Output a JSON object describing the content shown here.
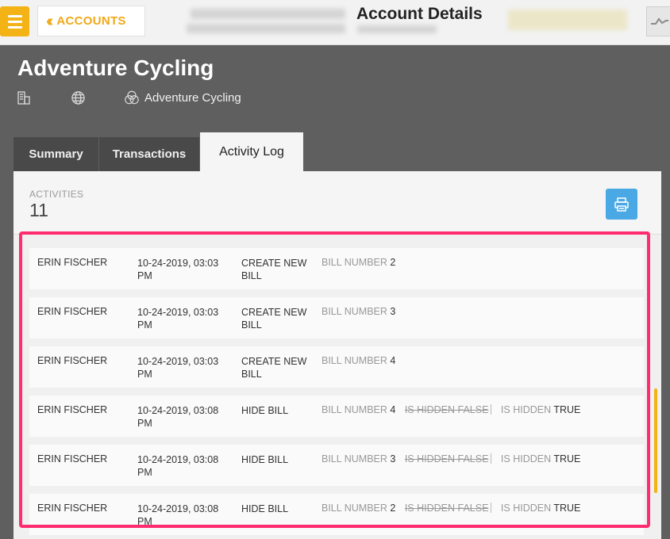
{
  "topbar": {
    "back_label": "ACCOUNTS",
    "title": "Account Details"
  },
  "account": {
    "name": "Adventure Cycling",
    "parent_name": "Adventure Cycling"
  },
  "tabs": [
    {
      "label": "Summary",
      "active": false
    },
    {
      "label": "Transactions",
      "active": false
    },
    {
      "label": "Activity Log",
      "active": true
    }
  ],
  "activity": {
    "label": "ACTIVITIES",
    "count": "11",
    "rows": [
      {
        "user": "ERIN FISCHER",
        "date": "10-24-2019, 03:03 PM",
        "action": "CREATE NEW BILL",
        "field1_label": "BILL NUMBER",
        "field1_value": "2"
      },
      {
        "user": "ERIN FISCHER",
        "date": "10-24-2019, 03:03 PM",
        "action": "CREATE NEW BILL",
        "field1_label": "BILL NUMBER",
        "field1_value": "3"
      },
      {
        "user": "ERIN FISCHER",
        "date": "10-24-2019, 03:03 PM",
        "action": "CREATE NEW BILL",
        "field1_label": "BILL NUMBER",
        "field1_value": "4"
      },
      {
        "user": "ERIN FISCHER",
        "date": "10-24-2019, 03:08 PM",
        "action": "HIDE BILL",
        "field1_label": "BILL NUMBER",
        "field1_value": "4",
        "old_value": "IS HIDDEN FALSE",
        "field2_label": "IS HIDDEN",
        "field2_value": "TRUE"
      },
      {
        "user": "ERIN FISCHER",
        "date": "10-24-2019, 03:08 PM",
        "action": "HIDE BILL",
        "field1_label": "BILL NUMBER",
        "field1_value": "3",
        "old_value": "IS HIDDEN FALSE",
        "field2_label": "IS HIDDEN",
        "field2_value": "TRUE"
      },
      {
        "user": "ERIN FISCHER",
        "date": "10-24-2019, 03:08 PM",
        "action": "HIDE BILL",
        "field1_label": "BILL NUMBER",
        "field1_value": "2",
        "old_value": "IS HIDDEN FALSE",
        "field2_label": "IS HIDDEN",
        "field2_value": "TRUE"
      }
    ]
  },
  "icons": {
    "menu": "hamburger-menu-icon",
    "back": "double-chevron-left-icon",
    "building": "building-icon",
    "globe": "globe-icon",
    "parent": "circles-icon",
    "print": "print-icon",
    "activity": "activity-line-icon"
  },
  "colors": {
    "accent": "#f4b315",
    "highlight": "#ff2d6f",
    "print_button": "#4aa8e4",
    "header_bg": "#5f5f5f"
  }
}
